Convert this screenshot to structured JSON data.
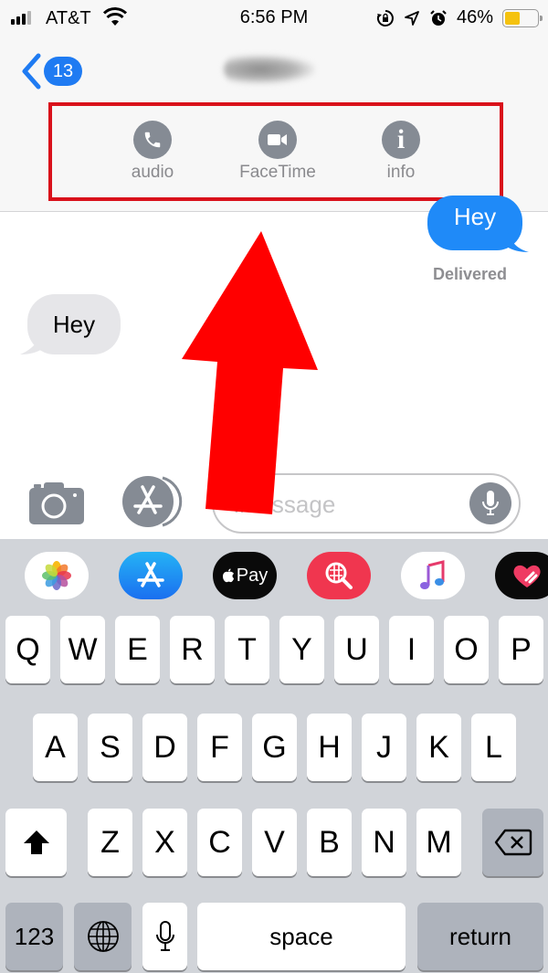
{
  "status_bar": {
    "carrier": "AT&T",
    "time": "6:56 PM",
    "battery_percent_label": "46%",
    "battery_level": 0.46,
    "signal_bars_active": 3,
    "signal_bars_total": 4,
    "icons": [
      "signal-icon",
      "wifi-icon",
      "rotation-lock-icon",
      "location-icon",
      "alarm-icon",
      "battery-icon"
    ]
  },
  "nav": {
    "back_icon": "chevron-left-icon",
    "unread_count": "13",
    "contact_name": "(blurred)"
  },
  "details": {
    "highlight_color": "#d9111b",
    "buttons": [
      {
        "label": "audio",
        "icon": "phone-icon"
      },
      {
        "label": "FaceTime",
        "icon": "video-camera-icon"
      },
      {
        "label": "info",
        "icon": "info-icon"
      }
    ]
  },
  "conversation": {
    "messages": [
      {
        "direction": "outgoing",
        "text": "Hey",
        "color": "#1f8af8"
      },
      {
        "direction": "incoming",
        "text": "Hey",
        "color": "#e6e6e9"
      }
    ],
    "delivery_status": "Delivered"
  },
  "compose": {
    "camera_icon": "camera-icon",
    "apps_icon": "app-store-icon",
    "placeholder": "iMessage",
    "visible_placeholder_fragment": "essage",
    "mic_icon": "microphone-icon"
  },
  "app_strip": [
    {
      "name": "Photos",
      "icon": "photos-icon"
    },
    {
      "name": "App Store",
      "icon": "app-store-icon"
    },
    {
      "name": "Apple Pay",
      "icon": "apple-pay-icon",
      "label": "Pay"
    },
    {
      "name": "Search Images",
      "icon": "image-search-icon"
    },
    {
      "name": "Music",
      "icon": "music-icon"
    },
    {
      "name": "Digital Touch",
      "icon": "digital-touch-icon"
    }
  ],
  "keyboard": {
    "row1": [
      "Q",
      "W",
      "E",
      "R",
      "T",
      "Y",
      "U",
      "I",
      "O",
      "P"
    ],
    "row2": [
      "A",
      "S",
      "D",
      "F",
      "G",
      "H",
      "J",
      "K",
      "L"
    ],
    "row3": [
      "Z",
      "X",
      "C",
      "V",
      "B",
      "N",
      "M"
    ],
    "shift_icon": "shift-icon",
    "delete_icon": "delete-icon",
    "numbers_label": "123",
    "globe_icon": "globe-icon",
    "dictation_icon": "microphone-icon",
    "space_label": "space",
    "return_label": "return"
  },
  "annotation": {
    "arrow_color": "#ff0000",
    "arrow_direction": "up"
  }
}
